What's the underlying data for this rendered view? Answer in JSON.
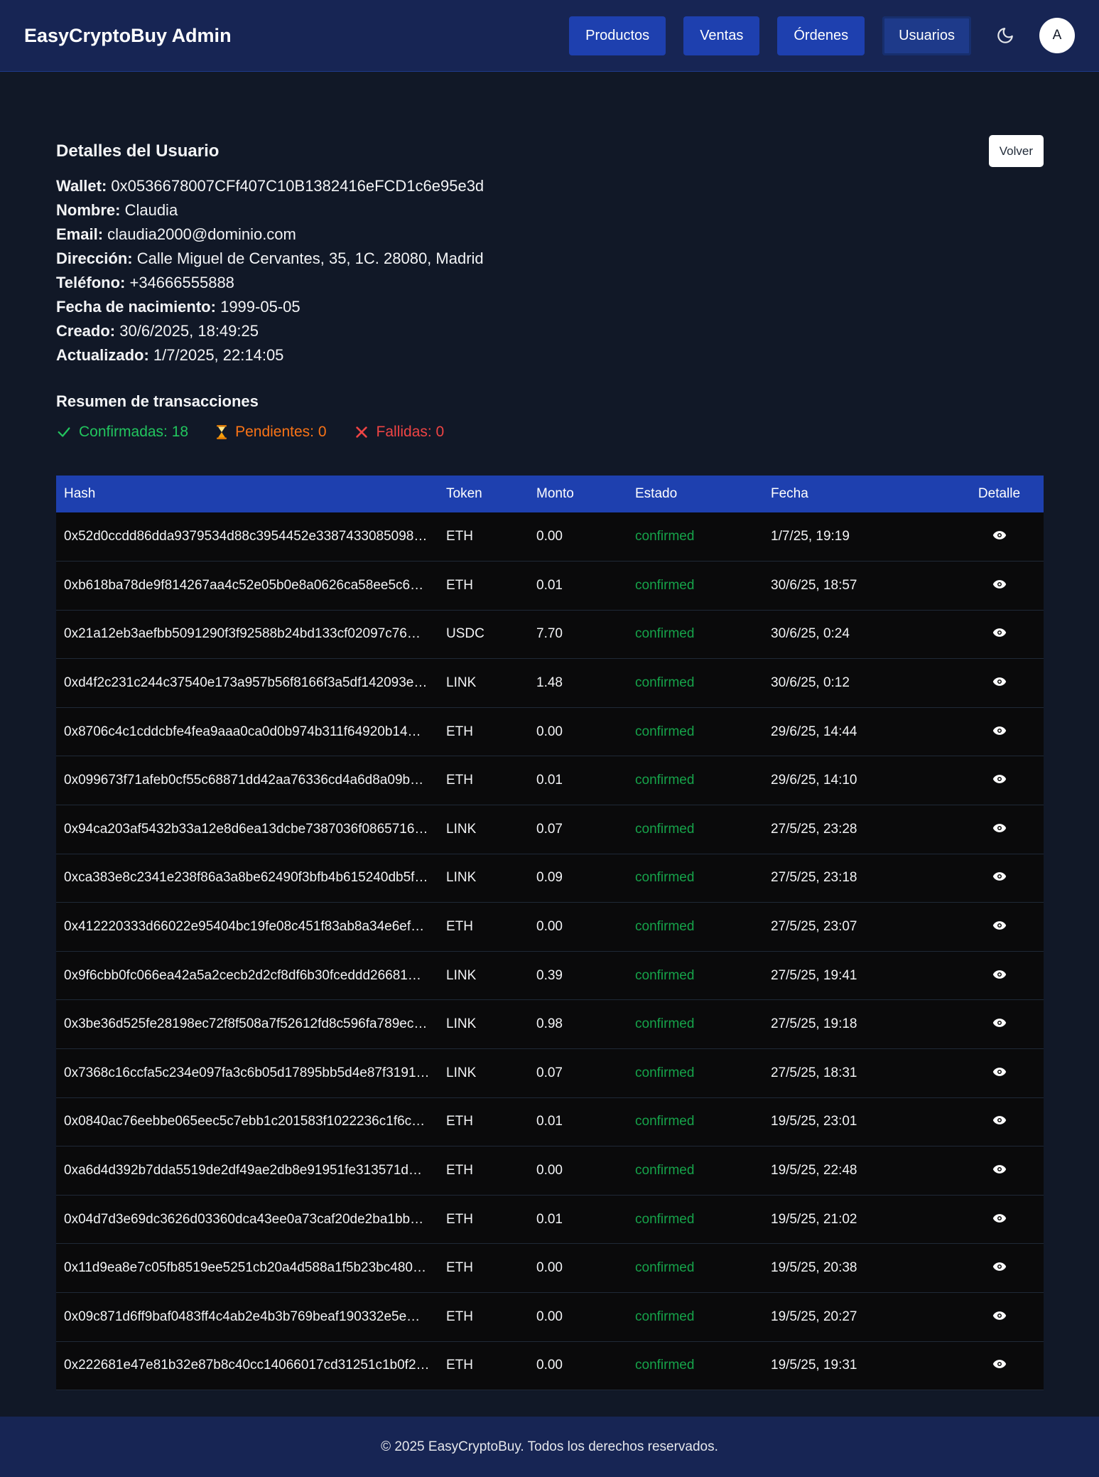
{
  "header": {
    "brand": "EasyCryptoBuy Admin",
    "nav": [
      {
        "label": "Productos",
        "active": false
      },
      {
        "label": "Ventas",
        "active": false
      },
      {
        "label": "Órdenes",
        "active": false
      },
      {
        "label": "Usuarios",
        "active": true
      }
    ],
    "theme_icon": "moon-icon",
    "avatar_letter": "A"
  },
  "user": {
    "title": "Detalles del Usuario",
    "back_label": "Volver",
    "fields": [
      {
        "label": "Wallet:",
        "value": "0x0536678007CFf407C10B1382416eFCD1c6e95e3d"
      },
      {
        "label": "Nombre:",
        "value": "Claudia"
      },
      {
        "label": "Email:",
        "value": "claudia2000@dominio.com"
      },
      {
        "label": "Dirección:",
        "value": "Calle Miguel de Cervantes, 35, 1C. 28080, Madrid"
      },
      {
        "label": "Teléfono:",
        "value": "+34666555888"
      },
      {
        "label": "Fecha de nacimiento:",
        "value": "1999-05-05"
      },
      {
        "label": "Creado:",
        "value": "30/6/2025, 18:49:25"
      },
      {
        "label": "Actualizado:",
        "value": "1/7/2025, 22:14:05"
      }
    ]
  },
  "summary": {
    "title": "Resumen de transacciones",
    "confirmed": "Confirmadas: 18",
    "pending": "Pendientes: 0",
    "failed": "Fallidas: 0",
    "colors": {
      "confirmed": "#22c55e",
      "pending": "#f97316",
      "failed": "#ef4444"
    }
  },
  "table": {
    "headers": [
      "Hash",
      "Token",
      "Monto",
      "Estado",
      "Fecha",
      "Detalle"
    ],
    "detail_icon": "eye-icon",
    "rows": [
      {
        "hash": "0x52d0ccdd86dda9379534d88c3954452e3387433085098…",
        "token": "ETH",
        "amount": "0.00",
        "status": "confirmed",
        "date": "1/7/25, 19:19"
      },
      {
        "hash": "0xb618ba78de9f814267aa4c52e05b0e8a0626ca58ee5c6d…",
        "token": "ETH",
        "amount": "0.01",
        "status": "confirmed",
        "date": "30/6/25, 18:57"
      },
      {
        "hash": "0x21a12eb3aefbb5091290f3f92588b24bd133cf02097c76…",
        "token": "USDC",
        "amount": "7.70",
        "status": "confirmed",
        "date": "30/6/25, 0:24"
      },
      {
        "hash": "0xd4f2c231c244c37540e173a957b56f8166f3a5df142093e…",
        "token": "LINK",
        "amount": "1.48",
        "status": "confirmed",
        "date": "30/6/25, 0:12"
      },
      {
        "hash": "0x8706c4c1cddcbfe4fea9aaa0ca0d0b974b311f64920b14…",
        "token": "ETH",
        "amount": "0.00",
        "status": "confirmed",
        "date": "29/6/25, 14:44"
      },
      {
        "hash": "0x099673f71afeb0cf55c68871dd42aa76336cd4a6d8a09b…",
        "token": "ETH",
        "amount": "0.01",
        "status": "confirmed",
        "date": "29/6/25, 14:10"
      },
      {
        "hash": "0x94ca203af5432b33a12e8d6ea13dcbe7387036f0865716…",
        "token": "LINK",
        "amount": "0.07",
        "status": "confirmed",
        "date": "27/5/25, 23:28"
      },
      {
        "hash": "0xca383e8c2341e238f86a3a8be62490f3bfb4b615240db5f…",
        "token": "LINK",
        "amount": "0.09",
        "status": "confirmed",
        "date": "27/5/25, 23:18"
      },
      {
        "hash": "0x412220333d66022e95404bc19fe08c451f83ab8a34e6ef…",
        "token": "ETH",
        "amount": "0.00",
        "status": "confirmed",
        "date": "27/5/25, 23:07"
      },
      {
        "hash": "0x9f6cbb0fc066ea42a5a2cecb2d2cf8df6b30fceddd26681…",
        "token": "LINK",
        "amount": "0.39",
        "status": "confirmed",
        "date": "27/5/25, 19:41"
      },
      {
        "hash": "0x3be36d525fe28198ec72f8f508a7f52612fd8c596fa789ec…",
        "token": "LINK",
        "amount": "0.98",
        "status": "confirmed",
        "date": "27/5/25, 19:18"
      },
      {
        "hash": "0x7368c16ccfa5c234e097fa3c6b05d17895bb5d4e87f3191…",
        "token": "LINK",
        "amount": "0.07",
        "status": "confirmed",
        "date": "27/5/25, 18:31"
      },
      {
        "hash": "0x0840ac76eebbe065eec5c7ebb1c201583f1022236c1f6c…",
        "token": "ETH",
        "amount": "0.01",
        "status": "confirmed",
        "date": "19/5/25, 23:01"
      },
      {
        "hash": "0xa6d4d392b7dda5519de2df49ae2db8e91951fe313571d…",
        "token": "ETH",
        "amount": "0.00",
        "status": "confirmed",
        "date": "19/5/25, 22:48"
      },
      {
        "hash": "0x04d7d3e69dc3626d03360dca43ee0a73caf20de2ba1bb…",
        "token": "ETH",
        "amount": "0.01",
        "status": "confirmed",
        "date": "19/5/25, 21:02"
      },
      {
        "hash": "0x11d9ea8e7c05fb8519ee5251cb20a4d588a1f5b23bc480…",
        "token": "ETH",
        "amount": "0.00",
        "status": "confirmed",
        "date": "19/5/25, 20:38"
      },
      {
        "hash": "0x09c871d6ff9baf0483ff4c4ab2e4b3b769beaf190332e5e…",
        "token": "ETH",
        "amount": "0.00",
        "status": "confirmed",
        "date": "19/5/25, 20:27"
      },
      {
        "hash": "0x222681e47e81b32e87b8c40cc14066017cd31251c1b0f2…",
        "token": "ETH",
        "amount": "0.00",
        "status": "confirmed",
        "date": "19/5/25, 19:31"
      }
    ]
  },
  "footer": {
    "text": "© 2025 EasyCryptoBuy. Todos los derechos reservados."
  }
}
